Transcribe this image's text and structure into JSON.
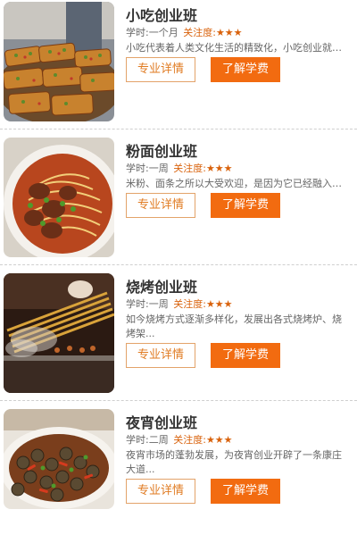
{
  "colors": {
    "accent_orange": "#f26b10",
    "detail_border": "#e3a36a",
    "attention": "#d9620c",
    "title_text": "#333333",
    "body_text": "#666666"
  },
  "courses": [
    {
      "title": "小吃创业班",
      "duration": "学时:一个月",
      "attention_label": "关注度:",
      "stars": "★★★",
      "description": "小吃代表着人类文化生活的精致化，小吃创业就是...",
      "detail_button": "专业详情",
      "fee_button": "了解学费",
      "image": "grilled-bread-snack-image"
    },
    {
      "title": "粉面创业班",
      "duration": "学时:一周",
      "attention_label": "关注度:",
      "stars": "★★★",
      "description": "米粉、面条之所以大受欢迎，是因为它已经融入了...",
      "detail_button": "专业详情",
      "fee_button": "了解学费",
      "image": "beef-noodle-bowl-image"
    },
    {
      "title": "烧烤创业班",
      "duration": "学时:一周",
      "attention_label": "关注度:",
      "stars": "★★★",
      "description": "如今烧烤方式逐渐多样化，发展出各式烧烤炉、烧烤架...",
      "detail_button": "专业详情",
      "fee_button": "了解学费",
      "image": "barbecue-skewers-image"
    },
    {
      "title": "夜宵创业班",
      "duration": "学时:二周",
      "attention_label": "关注度:",
      "stars": "★★★",
      "description": "夜宵市场的蓬勃发展，为夜宵创业开辟了一条康庄大道...",
      "detail_button": "专业详情",
      "fee_button": "了解学费",
      "image": "river-snails-image"
    }
  ]
}
